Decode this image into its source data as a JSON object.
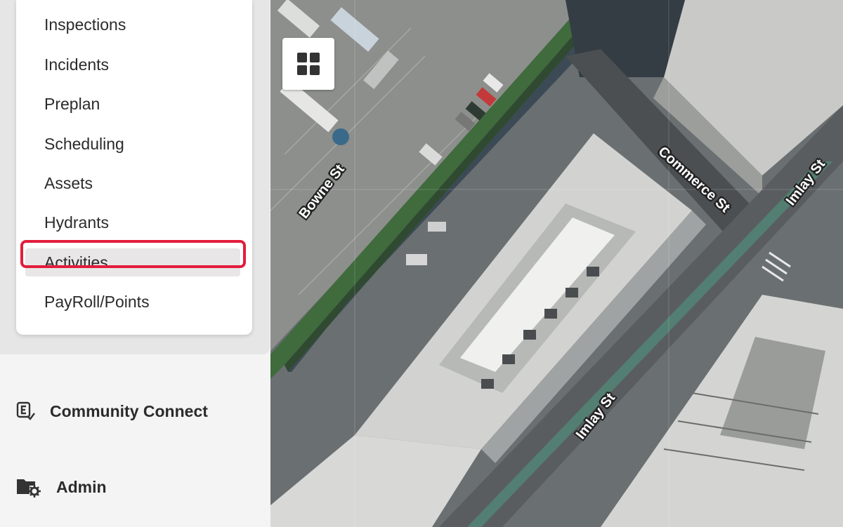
{
  "menu": {
    "items": [
      {
        "label": "Inspections"
      },
      {
        "label": "Incidents"
      },
      {
        "label": "Preplan"
      },
      {
        "label": "Scheduling"
      },
      {
        "label": "Assets"
      },
      {
        "label": "Hydrants"
      },
      {
        "label": "Activities",
        "active": true
      },
      {
        "label": "PayRoll/Points"
      }
    ]
  },
  "nav": {
    "community_connect": {
      "label": "Community Connect",
      "icon": "community-connect-icon"
    },
    "admin": {
      "label": "Admin",
      "icon": "folder-gear-icon"
    }
  },
  "map": {
    "view": "satellite",
    "streets": [
      {
        "label": "Bowne St"
      },
      {
        "label": "Commerce St"
      },
      {
        "label": "Imlay St"
      },
      {
        "label": "Imlay St"
      }
    ],
    "layer_button_icon": "grid-icon"
  },
  "colors": {
    "highlight": "#e11d3b",
    "active_bg": "#e8e6e6"
  }
}
